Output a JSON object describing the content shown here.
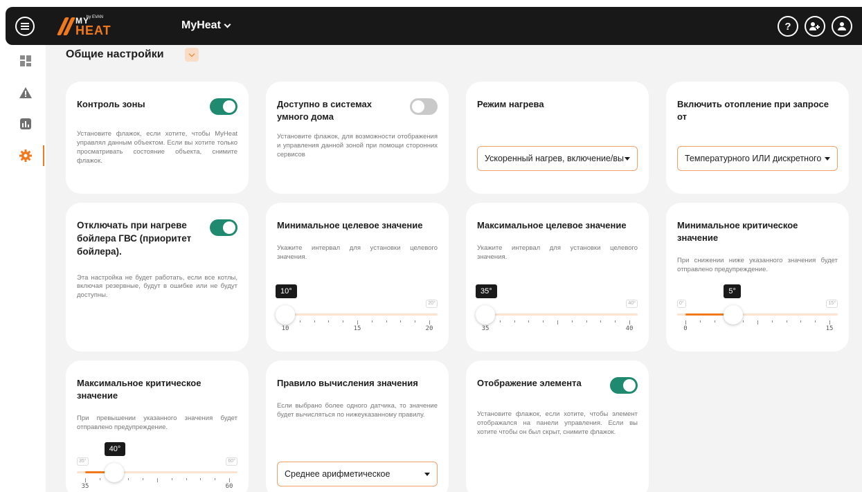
{
  "header": {
    "logo_top": "MY",
    "logo_bottom": "HEAT",
    "logo_by": "by EVAN",
    "object_name": "MyHeat",
    "help_label": "?"
  },
  "colors": {
    "accent": "#f0791e",
    "toggle_on": "#1f8a70",
    "toggle_off": "#c9c9c9",
    "header_bg": "#181818",
    "page_bg": "#f3f3f3"
  },
  "sidebar": {
    "items": [
      {
        "icon": "dashboard-icon"
      },
      {
        "icon": "warning-icon"
      },
      {
        "icon": "bar-chart-icon"
      },
      {
        "icon": "gear-icon",
        "active": true
      }
    ]
  },
  "page": {
    "title": "Общие настройки"
  },
  "cards": {
    "zone_control": {
      "title": "Контроль зоны",
      "enabled": true,
      "description": "Установите флажок, если хотите, чтобы MyHeat управлял данным объектом. Если вы хотите только просматривать состояние объекта, снимите флажок."
    },
    "smart_home": {
      "title": "Доступно в системах умного дома",
      "enabled": false,
      "description": "Установите флажок, для возможности отображения и управления данной зоной при помощи сторонних сервисов"
    },
    "heating_mode": {
      "title": "Режим нагрева",
      "value": "Ускоренный нагрев, включение/вы"
    },
    "heating_request": {
      "title": "Включить отопление при запросе от",
      "value": "Температурного ИЛИ дискретного"
    },
    "boiler_priority": {
      "title": "Отключать при нагреве бойлера ГВС (приоритет бойлера).",
      "enabled": true,
      "description": "Эта настройка не будет работать, если все котлы, включая резервные, будут в ошибке или не будут доступны."
    },
    "min_target": {
      "title": "Минимальное целевое значение",
      "description": "Укажите интервал для установки целевого значения.",
      "value_label": "10°",
      "min_label": "10",
      "mid_label": "15",
      "max_label": "20",
      "edge_left": "",
      "edge_right": "20°",
      "range": [
        10,
        20
      ],
      "value": 10
    },
    "max_target": {
      "title": "Максимальное целевое значение",
      "description": "Укажите интервал для установки целевого значения.",
      "value_label": "35°",
      "min_label": "35",
      "max_label": "40",
      "edge_left": "",
      "edge_right": "40°",
      "range": [
        35,
        40
      ],
      "value": 35
    },
    "min_critical": {
      "title": "Минимальное критическое значение",
      "description": "При снижении ниже указанного значения будет отправлено предупреждение.",
      "value_label": "5°",
      "min_label": "0",
      "max_label": "15",
      "edge_left": "0°",
      "edge_right": "15°",
      "range": [
        0,
        15
      ],
      "value": 5
    },
    "max_critical": {
      "title": "Максимальное критическое значение",
      "description": "При превышении указанного значения будет отправлено предупреждение.",
      "value_label": "40°",
      "min_label": "35",
      "max_label": "60",
      "edge_left": "35°",
      "edge_right": "60°",
      "range": [
        35,
        60
      ],
      "value": 40
    },
    "calc_rule": {
      "title": "Правило вычисления значения",
      "description": "Если выбрано более одного датчика, то значение будет вычисляться по нижеуказанному правилу.",
      "value": "Среднее арифметическое"
    },
    "display_element": {
      "title": "Отображение элемента",
      "enabled": true,
      "description": "Установите флажок, если хотите, чтобы элемент отображался на панели управления. Если вы хотите чтобы он был скрыт, снимите флажок."
    }
  }
}
